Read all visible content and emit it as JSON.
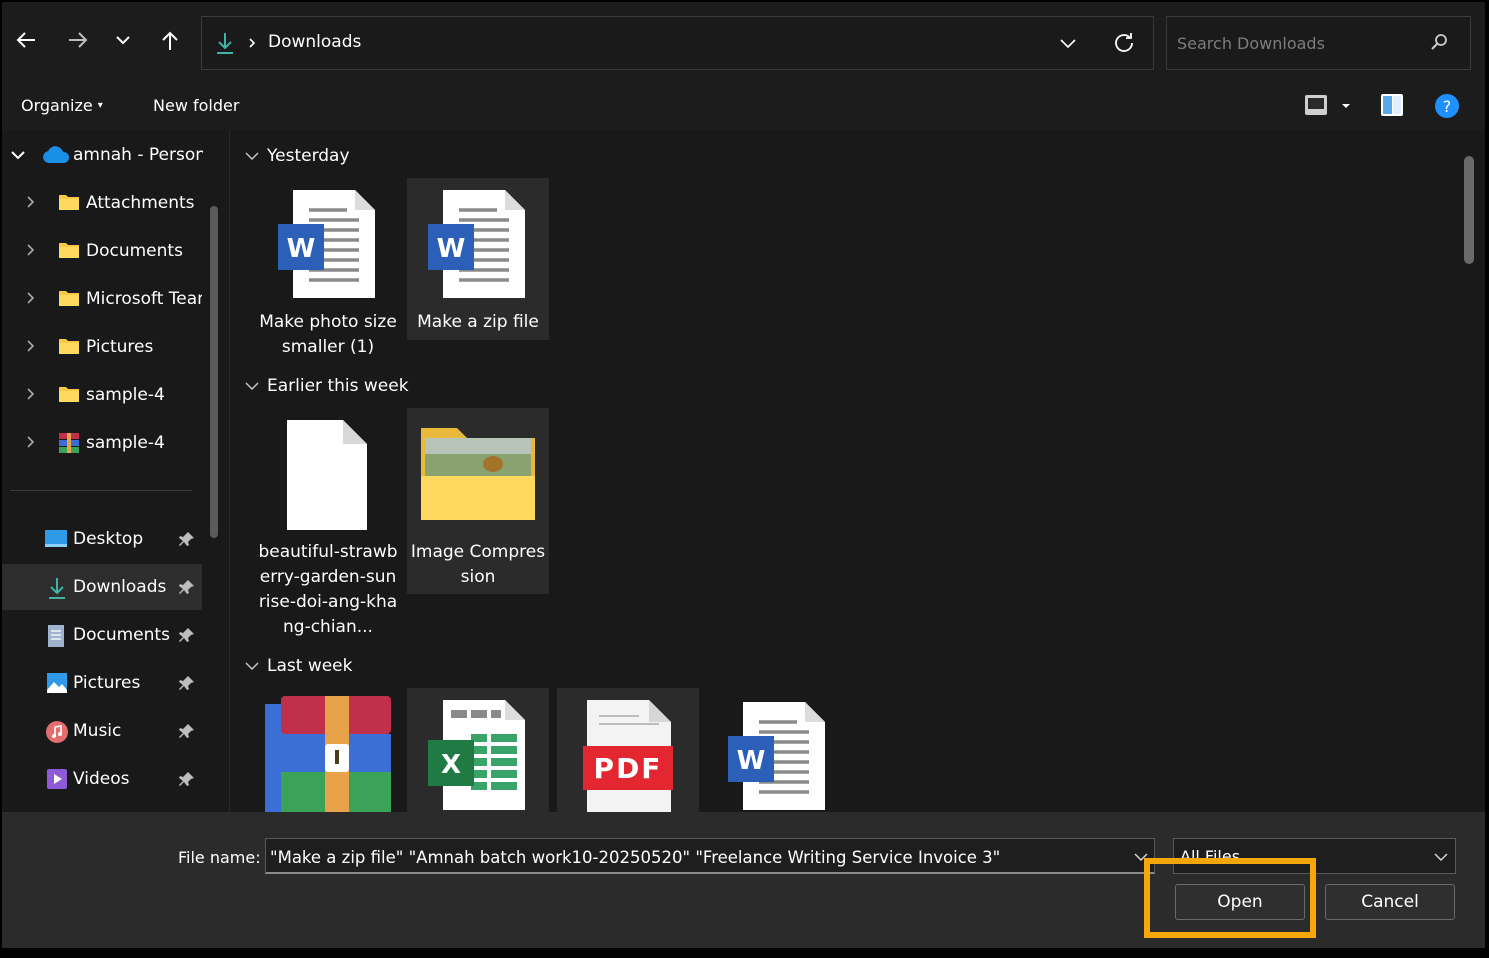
{
  "address": {
    "folder": "Downloads"
  },
  "search": {
    "placeholder": "Search Downloads"
  },
  "toolbar": {
    "organize": "Organize",
    "new_folder": "New folder"
  },
  "nav": {
    "account": "amnah - Persona",
    "tree": [
      "Attachments",
      "Documents",
      "Microsoft Team",
      "Pictures",
      "sample-4",
      "sample-4"
    ],
    "quick": [
      {
        "label": "Desktop",
        "icon": "desktop-icon"
      },
      {
        "label": "Downloads",
        "icon": "download-icon"
      },
      {
        "label": "Documents",
        "icon": "documents-icon"
      },
      {
        "label": "Pictures",
        "icon": "pictures-icon"
      },
      {
        "label": "Music",
        "icon": "music-icon"
      },
      {
        "label": "Videos",
        "icon": "videos-icon"
      }
    ]
  },
  "groups": {
    "yesterday": "Yesterday",
    "earlier": "Earlier this week",
    "last_week": "Last week"
  },
  "files": {
    "f1": "Make photo size smaller (1)",
    "f2": "Make a zip file",
    "f3": "beautiful-strawberry-garden-sunrise-doi-ang-khang-chian...",
    "f4": "Image Compression"
  },
  "bottom": {
    "file_name_label": "File name:",
    "file_name_value": "\"Make a zip file\" \"Amnah batch work10-20250520\" \"Freelance Writing Service Invoice 3\"",
    "file_type": "All Files",
    "open": "Open",
    "cancel": "Cancel"
  },
  "colors": {
    "highlight": "#f6a70b",
    "accent": "#1e90ff",
    "word": "#2b5fb8",
    "excel": "#1f7a44",
    "pdf": "#e3262f"
  }
}
